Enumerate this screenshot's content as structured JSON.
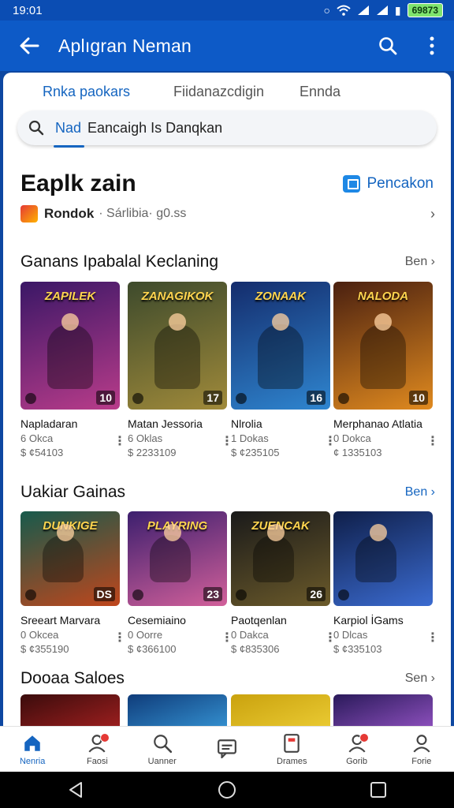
{
  "status": {
    "time": "19:01",
    "battery": "69873"
  },
  "app_bar": {
    "title": "Aplıgran Neman"
  },
  "tabs": [
    "Rnka paokars",
    "Fiidanazcdigin",
    "Ennda"
  ],
  "search": {
    "prefix": "Nad",
    "text": "Eancaigh Is Danqkan"
  },
  "app": {
    "name": "Eaplk zain",
    "action_label": "Pencakon",
    "developer": "Rondok",
    "developer_sub": "· Sárlibia· g0.ss"
  },
  "sections": [
    {
      "title": "Ganans Ipabalal Keclaning",
      "more": "Ben",
      "items": [
        {
          "name": "Napladaran",
          "meta1": "6 Okca",
          "meta2": "$ ¢54103",
          "badge": "10",
          "art": "ZAPILEK",
          "bg": [
            "#3a1766",
            "#b93c8a"
          ]
        },
        {
          "name": "Matan Jessoria",
          "meta1": "6 Oklas",
          "meta2": "$ 2233109",
          "badge": "17",
          "art": "ZANAGIKOK",
          "bg": [
            "#3d4a2c",
            "#a08a3a"
          ]
        },
        {
          "name": "Nlrolia",
          "meta1": "1 Dokas",
          "meta2": "$ ¢235105",
          "badge": "16",
          "art": "ZONAAK",
          "bg": [
            "#142c6c",
            "#2f86d0"
          ]
        },
        {
          "name": "Merphanao Atlatia",
          "meta1": "0 Dokca",
          "meta2": "¢ 1335103",
          "badge": "10",
          "art": "NALODA",
          "bg": [
            "#4a2010",
            "#e08a1f"
          ]
        }
      ]
    },
    {
      "title": "Uakiar Gainas",
      "more": "Ben",
      "items": [
        {
          "name": "Sreeart Marvara",
          "meta1": "0 Okcea",
          "meta2": "$ ¢355190",
          "badge": "DS",
          "art": "DUNKIGE",
          "bg": [
            "#175a4c",
            "#c0461c"
          ]
        },
        {
          "name": "Cesemiaino",
          "meta1": "0 Oorre",
          "meta2": "$ ¢366100",
          "badge": "23",
          "art": "PLAYRING",
          "bg": [
            "#3c1f6e",
            "#d2609a"
          ]
        },
        {
          "name": "Paotqenlan",
          "meta1": "0 Dakca",
          "meta2": "$ ¢835306",
          "badge": "26",
          "art": "ZUENCAK",
          "bg": [
            "#1a1a1a",
            "#6b5a2a"
          ]
        },
        {
          "name": "Karpiol İGams",
          "meta1": "0 Dlcas",
          "meta2": "$ ¢335103",
          "badge": "",
          "art": "",
          "bg": [
            "#0f1f4a",
            "#3b6bd0"
          ]
        }
      ]
    },
    {
      "title": "Dooaa Saloes",
      "more": "Sen",
      "items": [
        {
          "bg": [
            "#3a0c0c",
            "#b02222"
          ]
        },
        {
          "bg": [
            "#0f3c7a",
            "#3ba0e0"
          ]
        },
        {
          "bg": [
            "#caa20e",
            "#f0d23a"
          ]
        },
        {
          "bg": [
            "#2a1a5a",
            "#a05ad0"
          ]
        }
      ]
    }
  ],
  "bottom_nav": [
    {
      "label": "Nenria",
      "icon": "home-icon",
      "badge": false
    },
    {
      "label": "Faosi",
      "icon": "profile-icon",
      "badge": true
    },
    {
      "label": "Uanner",
      "icon": "search-icon",
      "badge": false
    },
    {
      "label": "",
      "icon": "chat-icon",
      "badge": false
    },
    {
      "label": "Drames",
      "icon": "bookmark-icon",
      "badge": false
    },
    {
      "label": "Gorib",
      "icon": "profile-icon",
      "badge": true
    },
    {
      "label": "Forie",
      "icon": "person-icon",
      "badge": false
    }
  ],
  "colors": {
    "primary": "#0d5ac7",
    "accent": "#1565c0",
    "badge": "#e53935"
  }
}
